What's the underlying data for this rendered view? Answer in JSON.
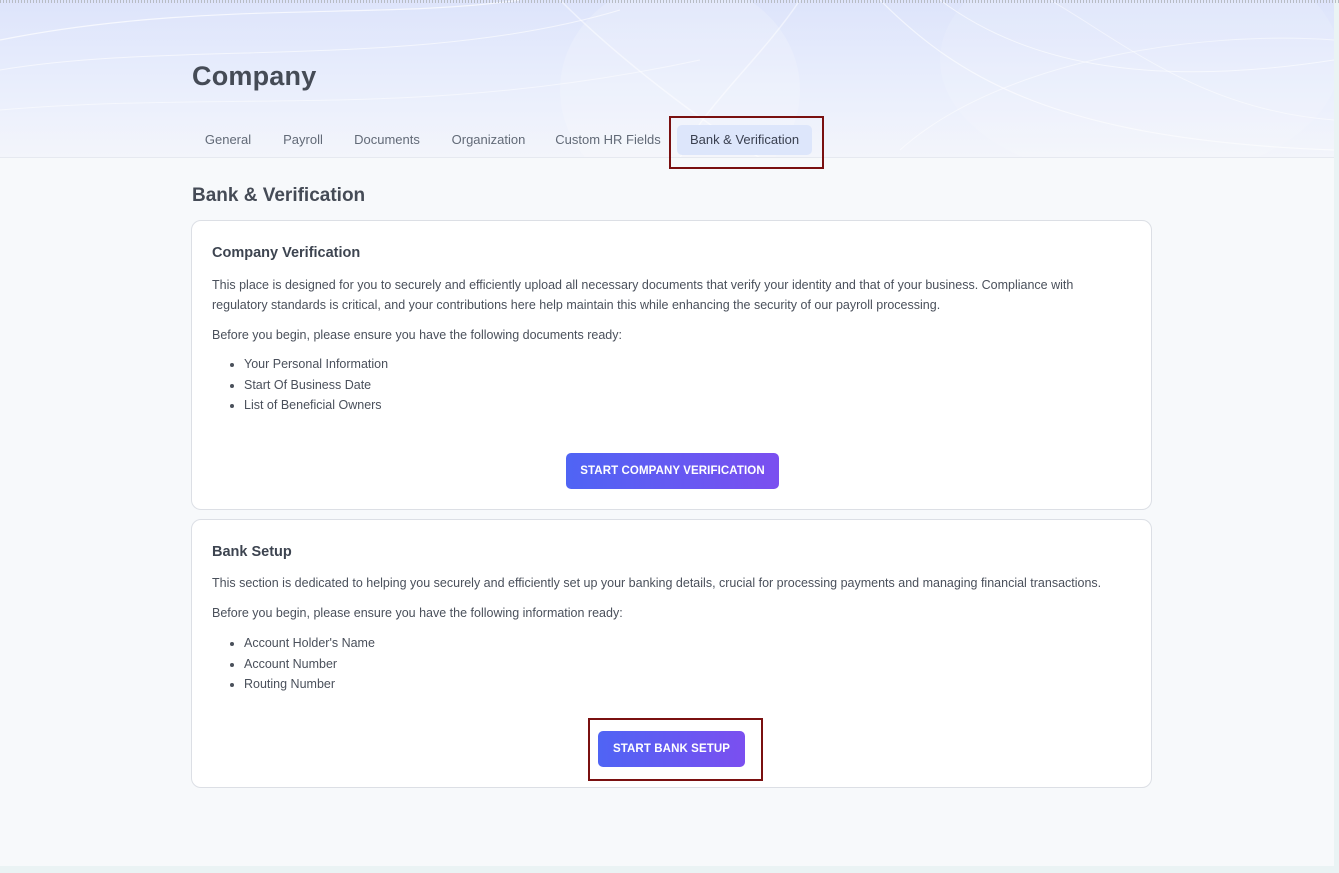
{
  "page": {
    "title": "Company",
    "section_title": "Bank & Verification"
  },
  "tabs": [
    {
      "label": "General",
      "active": false
    },
    {
      "label": "Payroll",
      "active": false
    },
    {
      "label": "Documents",
      "active": false
    },
    {
      "label": "Organization",
      "active": false
    },
    {
      "label": "Custom HR Fields",
      "active": false
    },
    {
      "label": "Bank & Verification",
      "active": true
    }
  ],
  "company_verification": {
    "title": "Company Verification",
    "description": "This place is designed for you to securely and efficiently upload all necessary documents that verify your identity and that of your business. Compliance with regulatory standards is critical, and your contributions here help maintain this while enhancing the security of our payroll processing.",
    "intro": "Before you begin, please ensure you have the following documents ready:",
    "items": [
      "Your Personal Information",
      "Start Of Business Date",
      "List of Beneficial Owners"
    ],
    "button_label": "START COMPANY VERIFICATION"
  },
  "bank_setup": {
    "title": "Bank Setup",
    "description": "This section is dedicated to helping you securely and efficiently set up your banking details, crucial for processing payments and managing financial transactions.",
    "intro": "Before you begin, please ensure you have the following information ready:",
    "items": [
      "Account Holder's Name",
      "Account Number",
      "Routing Number"
    ],
    "button_label": "START BANK SETUP"
  },
  "colors": {
    "accent_start": "#4f64f4",
    "accent_end": "#7b4ff0",
    "highlight": "#7a1010",
    "active_tab_bg": "#dde6fb"
  }
}
